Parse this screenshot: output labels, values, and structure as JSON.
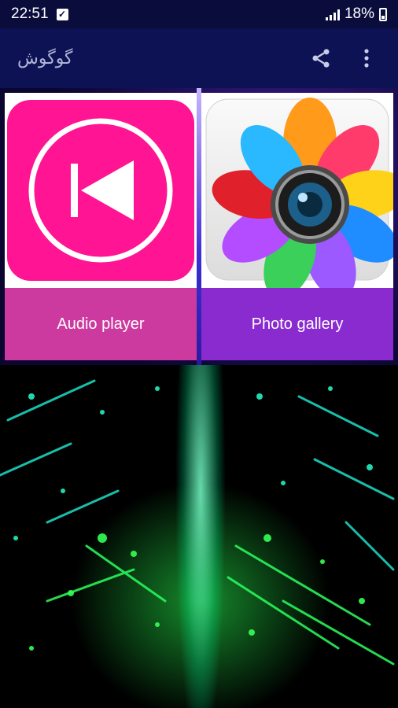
{
  "status_bar": {
    "time": "22:51",
    "battery_percent": "18%",
    "icons": [
      "checkbox-notification-icon",
      "signal-icon",
      "battery-icon"
    ]
  },
  "app_bar": {
    "title": "گوگوش",
    "icons": [
      "share-icon",
      "more-vert-icon"
    ]
  },
  "tiles": [
    {
      "label": "Audio player",
      "icon": "skip-previous-icon",
      "color": "#ff1493"
    },
    {
      "label": "Photo gallery",
      "icon": "photo-gallery-camera-icon",
      "color": "#8a2bd0"
    }
  ],
  "colors": {
    "status_bar": "#0a0c3c",
    "app_bar": "#0d1254",
    "audio_label_bg": "#cd3a9f",
    "gallery_label_bg": "#8a2bd0"
  }
}
